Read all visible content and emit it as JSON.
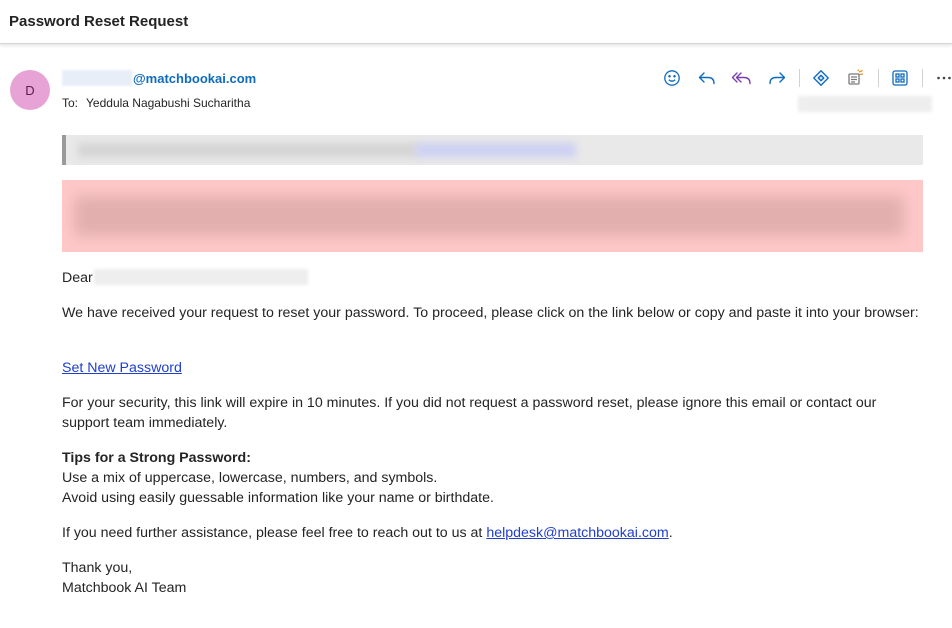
{
  "subject": "Password Reset Request",
  "sender": {
    "avatar_initial": "D",
    "email_domain": "@matchbookai.com"
  },
  "recipients": {
    "to_label": "To:",
    "to_name": "Yeddula Nagabushi Sucharitha"
  },
  "toolbar": {
    "icons": [
      "emoji-icon",
      "reply-icon",
      "reply-all-icon",
      "forward-icon",
      "loop-icon",
      "immersive-reader-icon",
      "apps-icon",
      "more-icon"
    ],
    "accent_color": "#0f6cbd"
  },
  "body": {
    "greeting": "Dear",
    "paragraph1": "We have received your request to reset your password. To proceed, please click on the link below or copy and paste it into your browser:",
    "reset_link": "Set New Password",
    "paragraph2": "For your security, this link will expire in 10 minutes. If you did not request a password reset, please ignore this email or contact our support team immediately.",
    "tips_title": "Tips for a Strong Password:",
    "tip1": "Use a mix of uppercase, lowercase, numbers, and symbols.",
    "tip2": "Avoid using easily guessable information like your name or birthdate.",
    "assistance_prefix": "If you need further assistance, please feel free to reach out to us at ",
    "helpdesk_email": "helpdesk@matchbookai.com",
    "assistance_suffix": ".",
    "closing": "Thank you,",
    "signature": "Matchbook AI Team"
  }
}
